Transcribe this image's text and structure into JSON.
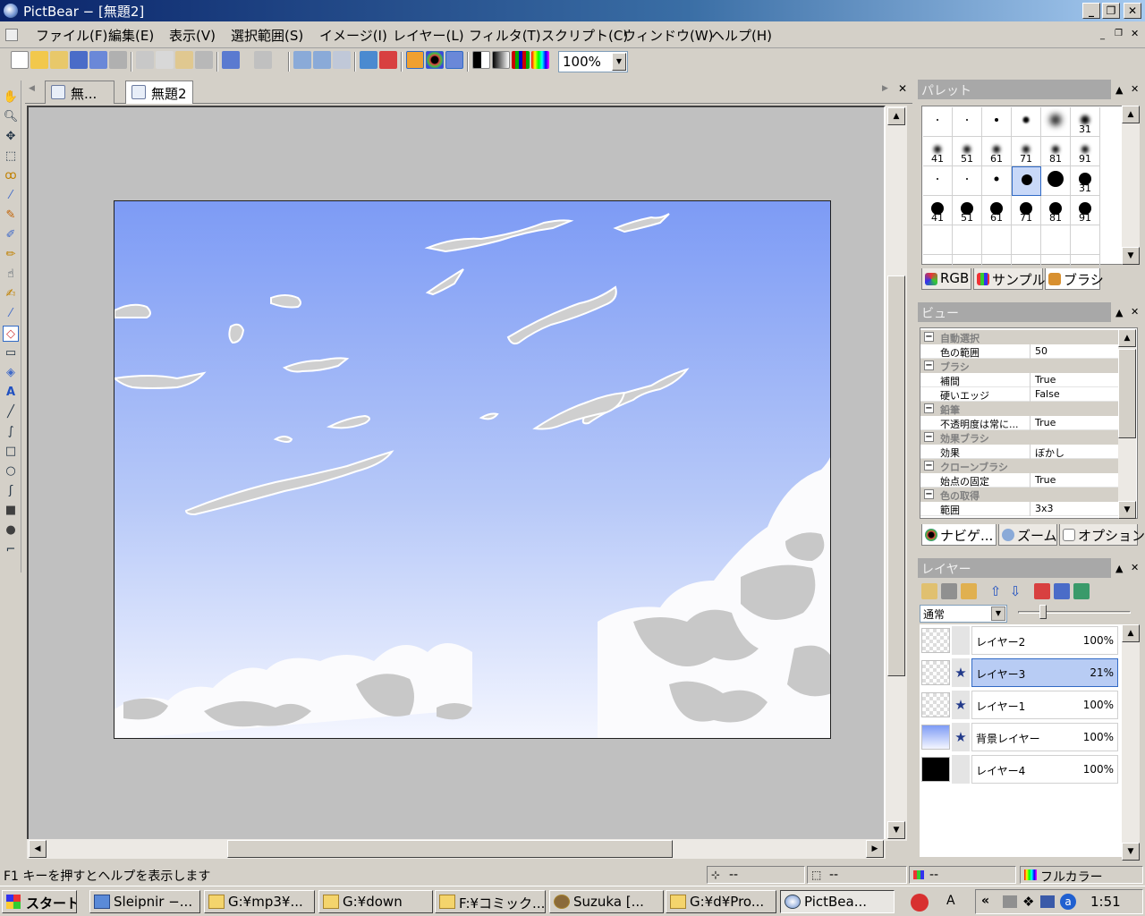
{
  "window": {
    "title": "PictBear − [無題2]"
  },
  "menu": [
    "ファイル(F)",
    "編集(E)",
    "表示(V)",
    "選択範囲(S)",
    "イメージ(I)",
    "レイヤー(L)",
    "フィルタ(T)",
    "スクリプト(C)",
    "ウィンドウ(W)",
    "ヘルプ(H)"
  ],
  "toolbar": {
    "zoom": "100%"
  },
  "tabs": [
    {
      "label": "無..."
    },
    {
      "label": "無題2"
    }
  ],
  "palette": {
    "title": "パレット",
    "brushes": [
      "",
      "",
      "",
      "",
      "",
      "31",
      "41",
      "51",
      "61",
      "71",
      "81",
      "91",
      "",
      "",
      "",
      "",
      "",
      "31",
      "41",
      "51",
      "61",
      "71",
      "81",
      "91"
    ],
    "tabs": [
      "RGB",
      "サンプル",
      "ブラシ"
    ]
  },
  "view": {
    "title": "ビュー",
    "rows": [
      {
        "type": "cat",
        "key": "自動選択"
      },
      {
        "type": "item",
        "key": "色の範囲",
        "value": "50"
      },
      {
        "type": "cat",
        "key": "ブラシ"
      },
      {
        "type": "item",
        "key": "補間",
        "value": "True"
      },
      {
        "type": "item",
        "key": "硬いエッジ",
        "value": "False"
      },
      {
        "type": "cat",
        "key": "鉛筆"
      },
      {
        "type": "item",
        "key": "不透明度は常に...",
        "value": "True"
      },
      {
        "type": "cat",
        "key": "効果ブラシ"
      },
      {
        "type": "item",
        "key": "効果",
        "value": "ぼかし"
      },
      {
        "type": "cat",
        "key": "クローンブラシ"
      },
      {
        "type": "item",
        "key": "始点の固定",
        "value": "True"
      },
      {
        "type": "cat",
        "key": "色の取得"
      },
      {
        "type": "item",
        "key": "範囲",
        "value": "3x3"
      }
    ],
    "tabs": [
      "ナビゲ...",
      "ズーム",
      "オプション"
    ]
  },
  "layers": {
    "title": "レイヤー",
    "blend_mode": "通常",
    "items": [
      {
        "name": "レイヤー2",
        "opacity": "100%",
        "visible": ""
      },
      {
        "name": "レイヤー3",
        "opacity": "21%",
        "visible": "★"
      },
      {
        "name": "レイヤー1",
        "opacity": "100%",
        "visible": "★"
      },
      {
        "name": "背景レイヤー",
        "opacity": "100%",
        "visible": "★"
      },
      {
        "name": "レイヤー4",
        "opacity": "100%",
        "visible": ""
      }
    ]
  },
  "status": {
    "help": "F1 キーを押すとヘルプを表示します",
    "pos": "--",
    "size": "--",
    "color_pos": "--",
    "mode": "フルカラー"
  },
  "taskbar": {
    "start": "スタート",
    "items": [
      "Sleipnir −...",
      "G:¥mp3¥...",
      "G:¥down",
      "F:¥コミック...",
      "Suzuka [...",
      "G:¥d¥Pro...",
      "PictBea..."
    ],
    "time": "1:51"
  }
}
